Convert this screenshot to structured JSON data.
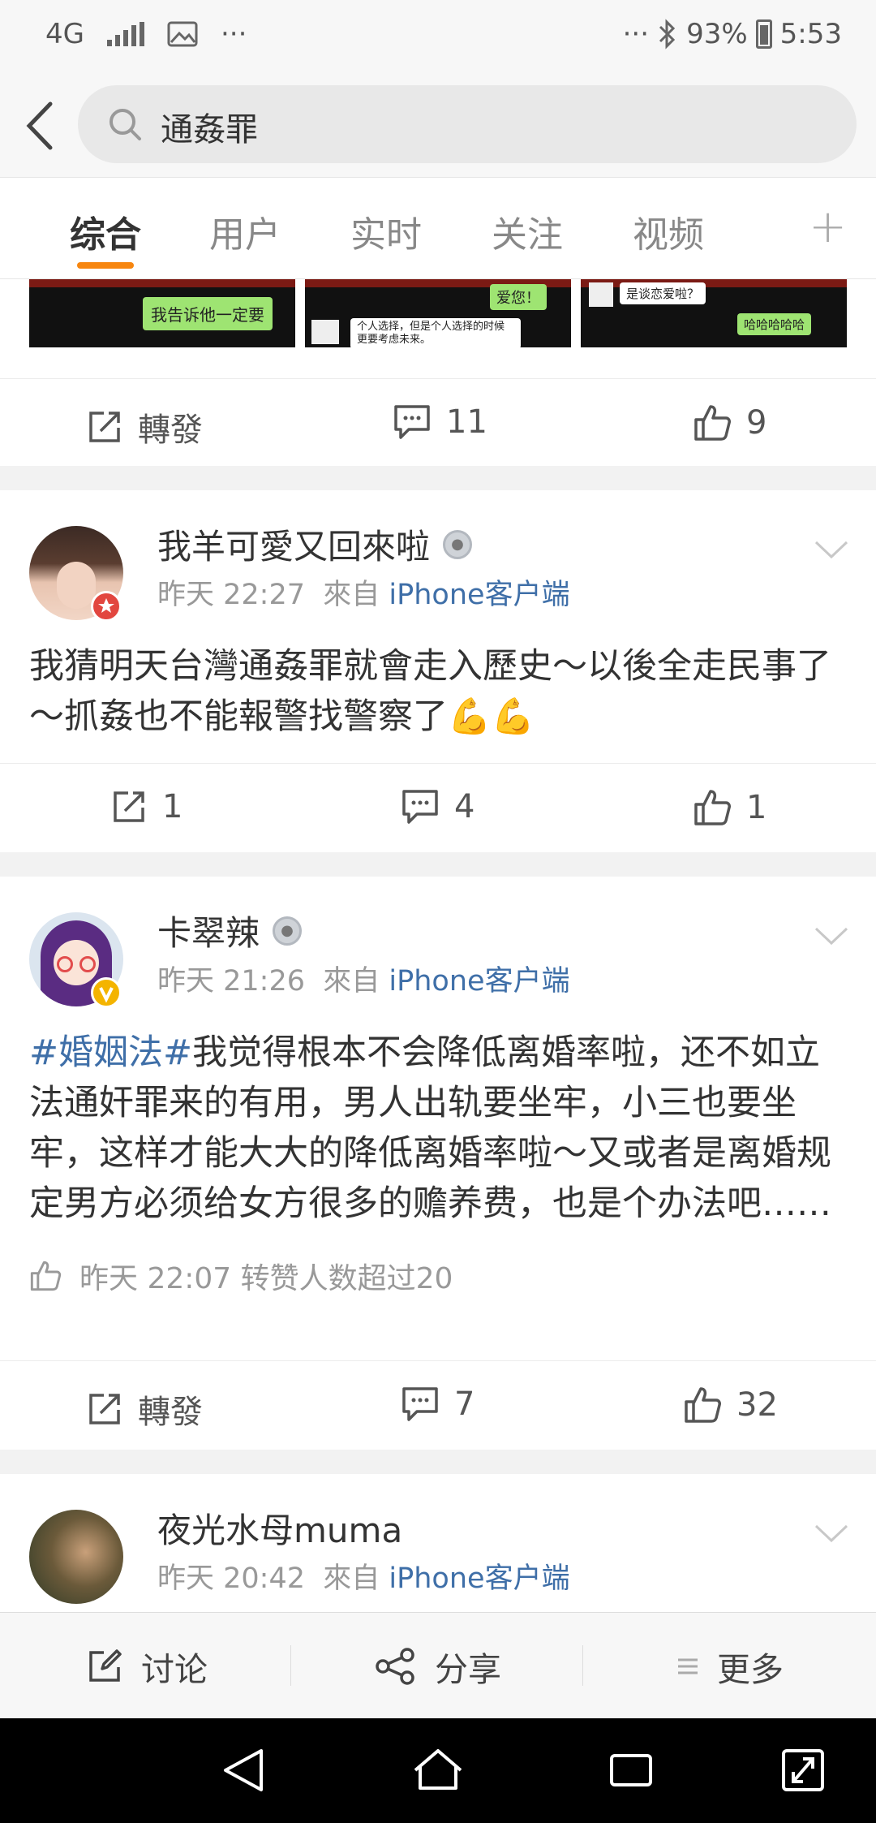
{
  "status_bar": {
    "network": "4G",
    "more": "···",
    "battery": "93%",
    "time": "5:53"
  },
  "search": {
    "query": "通姦罪"
  },
  "tabs": [
    "综合",
    "用户",
    "实时",
    "关注",
    "视频"
  ],
  "posts": [
    {
      "images": [
        {
          "bubble": "我告诉他一定要"
        },
        {
          "bubble_top": "爱您！",
          "bubble_bottom": "个人选择，但是个人选择的时候更要考虑未来。"
        },
        {
          "bubble_top": "是谈恋爱啦？",
          "bubble_bottom": "哈哈哈哈哈"
        }
      ],
      "actions": {
        "repost": "轉發",
        "comments": "11",
        "likes": "9"
      }
    },
    {
      "author": "我羊可愛又回來啦",
      "time": "昨天 22:27",
      "from_label": "來自",
      "source": "iPhone客户端",
      "text": "我猜明天台灣通姦罪就會走入歷史～以後全走民事了～抓姦也不能報警找警察了💪💪",
      "actions": {
        "repost": "1",
        "comments": "4",
        "likes": "1"
      }
    },
    {
      "author": "卡翠辣",
      "time": "昨天 21:26",
      "from_label": "來自",
      "source": "iPhone客户端",
      "hashtag": "#婚姻法#",
      "text": "我觉得根本不会降低离婚率啦，还不如立法通奸罪来的有用，男人出轨要坐牢，小三也要坐牢，这样才能大大的降低离婚率啦～又或者是离婚规定男方必须给女方很多的赡养费，也是个办法吧……",
      "like_summary": "昨天 22:07 转赞人数超过20",
      "actions": {
        "repost": "轉發",
        "comments": "7",
        "likes": "32"
      }
    },
    {
      "author": "夜光水母muma",
      "time": "昨天 20:42",
      "from_label": "來自",
      "source": "iPhone客户端"
    }
  ],
  "bottom_bar": {
    "discuss": "讨论",
    "share": "分享",
    "more": "更多"
  },
  "colors": {
    "accent": "#f7860f",
    "link": "#3f6fa8"
  }
}
